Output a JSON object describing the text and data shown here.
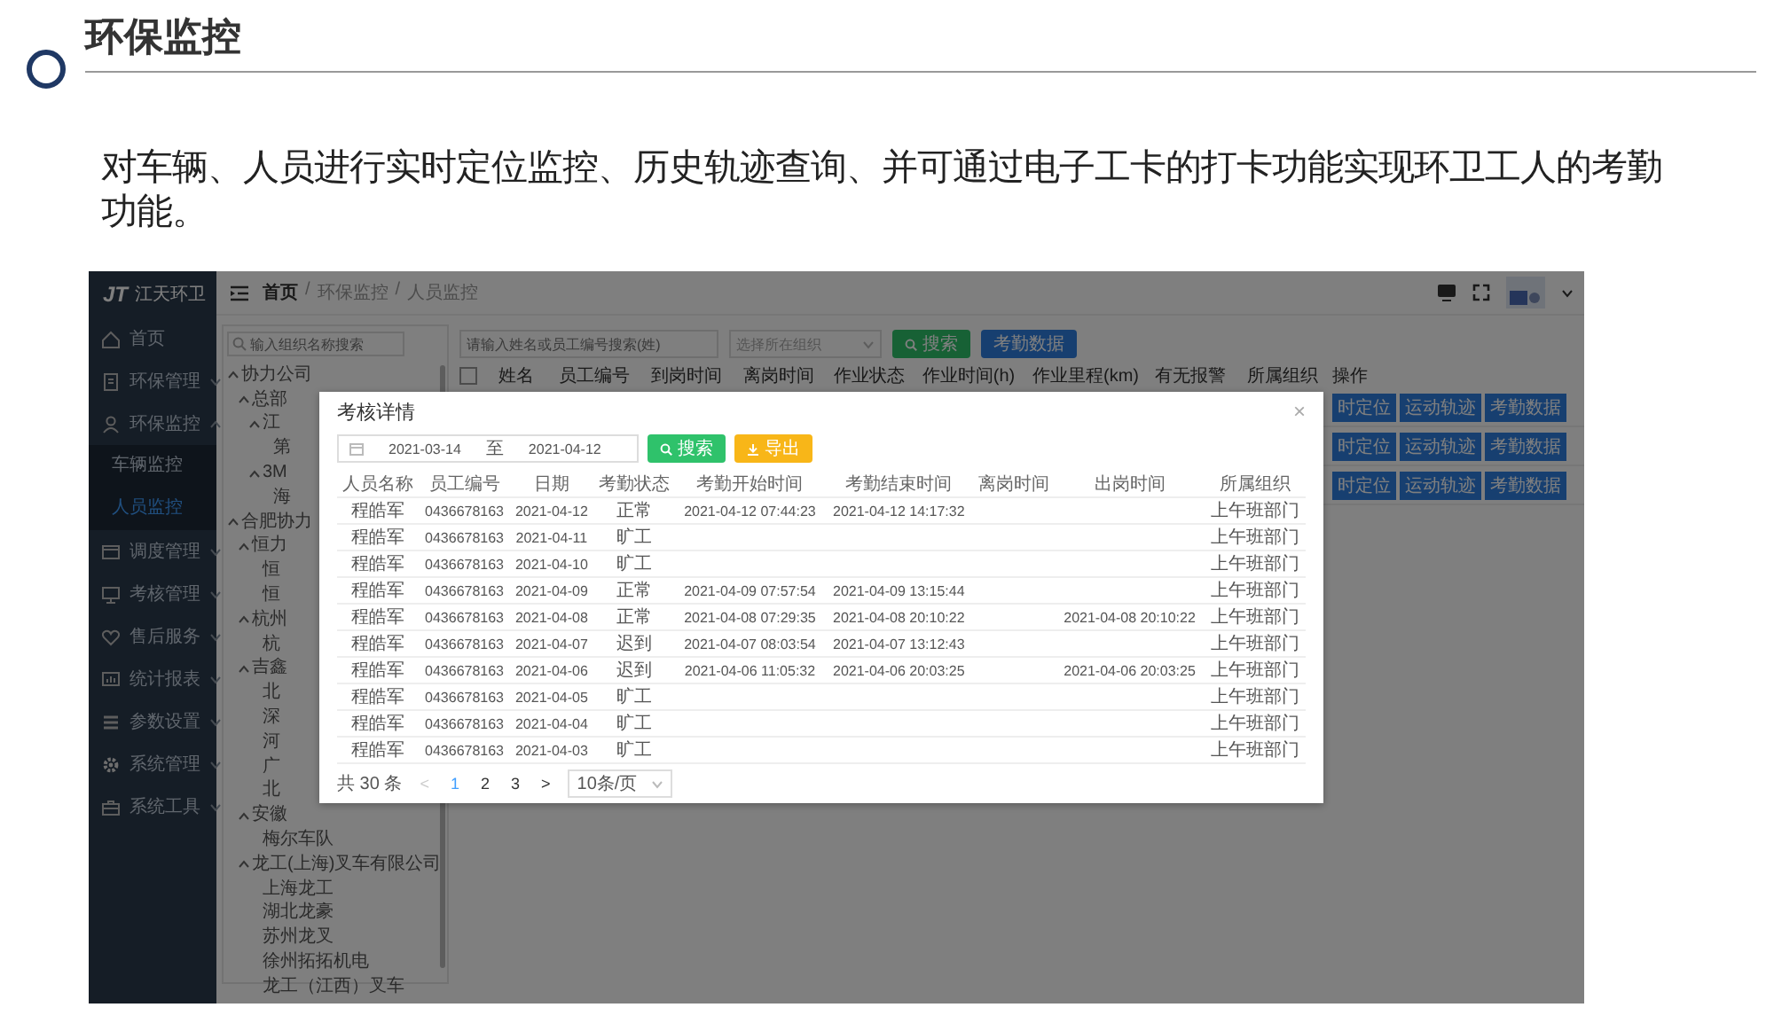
{
  "slide": {
    "title": "环保监控",
    "description": "对车辆、人员进行实时定位监控、历史轨迹查询、并可通过电子工卡的打卡功能实现环卫工人的考勤功能。"
  },
  "app": {
    "logo": {
      "mark": "JT",
      "name": "江天环卫"
    },
    "sidebar": {
      "items": [
        {
          "label": "首页",
          "kind": "home"
        },
        {
          "label": "环保管理",
          "kind": "folder",
          "expanded": false
        },
        {
          "label": "环保监控",
          "kind": "person",
          "expanded": true,
          "children": [
            {
              "label": "车辆监控",
              "selected": false
            },
            {
              "label": "人员监控",
              "selected": true
            }
          ]
        },
        {
          "label": "调度管理",
          "kind": "window",
          "expanded": false
        },
        {
          "label": "考核管理",
          "kind": "monitor",
          "expanded": false
        },
        {
          "label": "售后服务",
          "kind": "heart",
          "expanded": false
        },
        {
          "label": "统计报表",
          "kind": "chart",
          "expanded": false
        },
        {
          "label": "参数设置",
          "kind": "list",
          "expanded": false
        },
        {
          "label": "系统管理",
          "kind": "gear",
          "expanded": false
        },
        {
          "label": "系统工具",
          "kind": "wrench",
          "expanded": false
        }
      ]
    },
    "breadcrumb": {
      "separator": "/",
      "items": [
        "首页",
        "环保监控",
        "人员监控"
      ]
    },
    "tree": {
      "search": {
        "placeholder": "输入组织名称搜索"
      },
      "nodes": [
        {
          "label": "协力公司",
          "expanded": true,
          "children": [
            {
              "label": "总部",
              "expanded": true,
              "children": [
                {
                  "label": "江",
                  "expanded": true,
                  "children": [
                    {
                      "label": "第"
                    }
                  ]
                },
                {
                  "label": "3M",
                  "expanded": true,
                  "children": [
                    {
                      "label": "海"
                    }
                  ]
                }
              ]
            }
          ]
        },
        {
          "label": "合肥协力",
          "expanded": true,
          "children": [
            {
              "label": "恒力",
              "expanded": true,
              "children": [
                {
                  "label": "恒"
                },
                {
                  "label": "恒"
                }
              ]
            },
            {
              "label": "杭州",
              "expanded": true,
              "children": [
                {
                  "label": "杭"
                }
              ]
            },
            {
              "label": "吉鑫",
              "expanded": true,
              "children": [
                {
                  "label": "北"
                },
                {
                  "label": "深"
                },
                {
                  "label": "河"
                },
                {
                  "label": "广"
                },
                {
                  "label": "北"
                }
              ]
            },
            {
              "label": "安徽",
              "expanded": true,
              "children": [
                {
                  "label": "梅尔车队"
                }
              ]
            },
            {
              "label": "龙工(上海)叉车有限公司",
              "expanded": true,
              "children": [
                {
                  "label": "上海龙工"
                },
                {
                  "label": "湖北龙豪"
                },
                {
                  "label": "苏州龙叉"
                },
                {
                  "label": "徐州拓拓机电"
                },
                {
                  "label": "龙工（江西）叉车"
                }
              ]
            }
          ]
        }
      ]
    },
    "filters": {
      "search": {
        "placeholder": "请输入姓名或员工编号搜索(姓)"
      },
      "org_select": {
        "placeholder": "选择所在组织"
      },
      "buttons": [
        {
          "label": "搜索",
          "kind": "search"
        },
        {
          "label": "考勤数据",
          "kind": "primary"
        }
      ]
    },
    "table": {
      "select_all": {
        "checked": false
      },
      "columns": [
        "姓名",
        "员工编号",
        "到岗时间",
        "离岗时间",
        "作业状态",
        "作业时间(h)",
        "作业里程(km)",
        "有无报警",
        "所属组织",
        "操作"
      ],
      "rows": [
        {
          "actions": [
            "时定位",
            "运动轨迹",
            "考勤数据"
          ]
        },
        {
          "actions": [
            "时定位",
            "运动轨迹",
            "考勤数据"
          ]
        },
        {
          "actions": [
            "时定位",
            "运动轨迹",
            "考勤数据"
          ]
        }
      ]
    },
    "modal": {
      "title": "考核详情",
      "close": "×",
      "date_range": {
        "start": "2021-03-14",
        "separator": "至",
        "end": "2021-04-12"
      },
      "buttons": [
        {
          "label": "搜索",
          "kind": "search"
        },
        {
          "label": "导出",
          "kind": "export"
        }
      ],
      "columns": [
        "人员名称",
        "员工编号",
        "日期",
        "考勤状态",
        "考勤开始时间",
        "考勤结束时间",
        "离岗时间",
        "出岗时间",
        "所属组织"
      ],
      "rows": [
        [
          "程皓军",
          "0436678163",
          "2021-04-12",
          "正常",
          "2021-04-12 07:44:23",
          "2021-04-12 14:17:32",
          null,
          null,
          "上午班部门"
        ],
        [
          "程皓军",
          "0436678163",
          "2021-04-11",
          "旷工",
          null,
          null,
          null,
          null,
          "上午班部门"
        ],
        [
          "程皓军",
          "0436678163",
          "2021-04-10",
          "旷工",
          null,
          null,
          null,
          null,
          "上午班部门"
        ],
        [
          "程皓军",
          "0436678163",
          "2021-04-09",
          "正常",
          "2021-04-09 07:57:54",
          "2021-04-09 13:15:44",
          null,
          null,
          "上午班部门"
        ],
        [
          "程皓军",
          "0436678163",
          "2021-04-08",
          "正常",
          "2021-04-08 07:29:35",
          "2021-04-08 20:10:22",
          null,
          "2021-04-08 20:10:22",
          "上午班部门"
        ],
        [
          "程皓军",
          "0436678163",
          "2021-04-07",
          "迟到",
          "2021-04-07 08:03:54",
          "2021-04-07 13:12:43",
          null,
          null,
          "上午班部门"
        ],
        [
          "程皓军",
          "0436678163",
          "2021-04-06",
          "迟到",
          "2021-04-06 11:05:32",
          "2021-04-06 20:03:25",
          null,
          "2021-04-06 20:03:25",
          "上午班部门"
        ],
        [
          "程皓军",
          "0436678163",
          "2021-04-05",
          "旷工",
          null,
          null,
          null,
          null,
          "上午班部门"
        ],
        [
          "程皓军",
          "0436678163",
          "2021-04-04",
          "旷工",
          null,
          null,
          null,
          null,
          "上午班部门"
        ],
        [
          "程皓军",
          "0436678163",
          "2021-04-03",
          "旷工",
          null,
          null,
          null,
          null,
          "上午班部门"
        ]
      ],
      "pagination": {
        "total": "共 30 条",
        "prev": "<",
        "pages": [
          {
            "label": "1",
            "selected": true
          },
          {
            "label": "2",
            "selected": false
          },
          {
            "label": "3",
            "selected": false
          }
        ],
        "next": ">",
        "page_size": "10条/页"
      }
    }
  }
}
